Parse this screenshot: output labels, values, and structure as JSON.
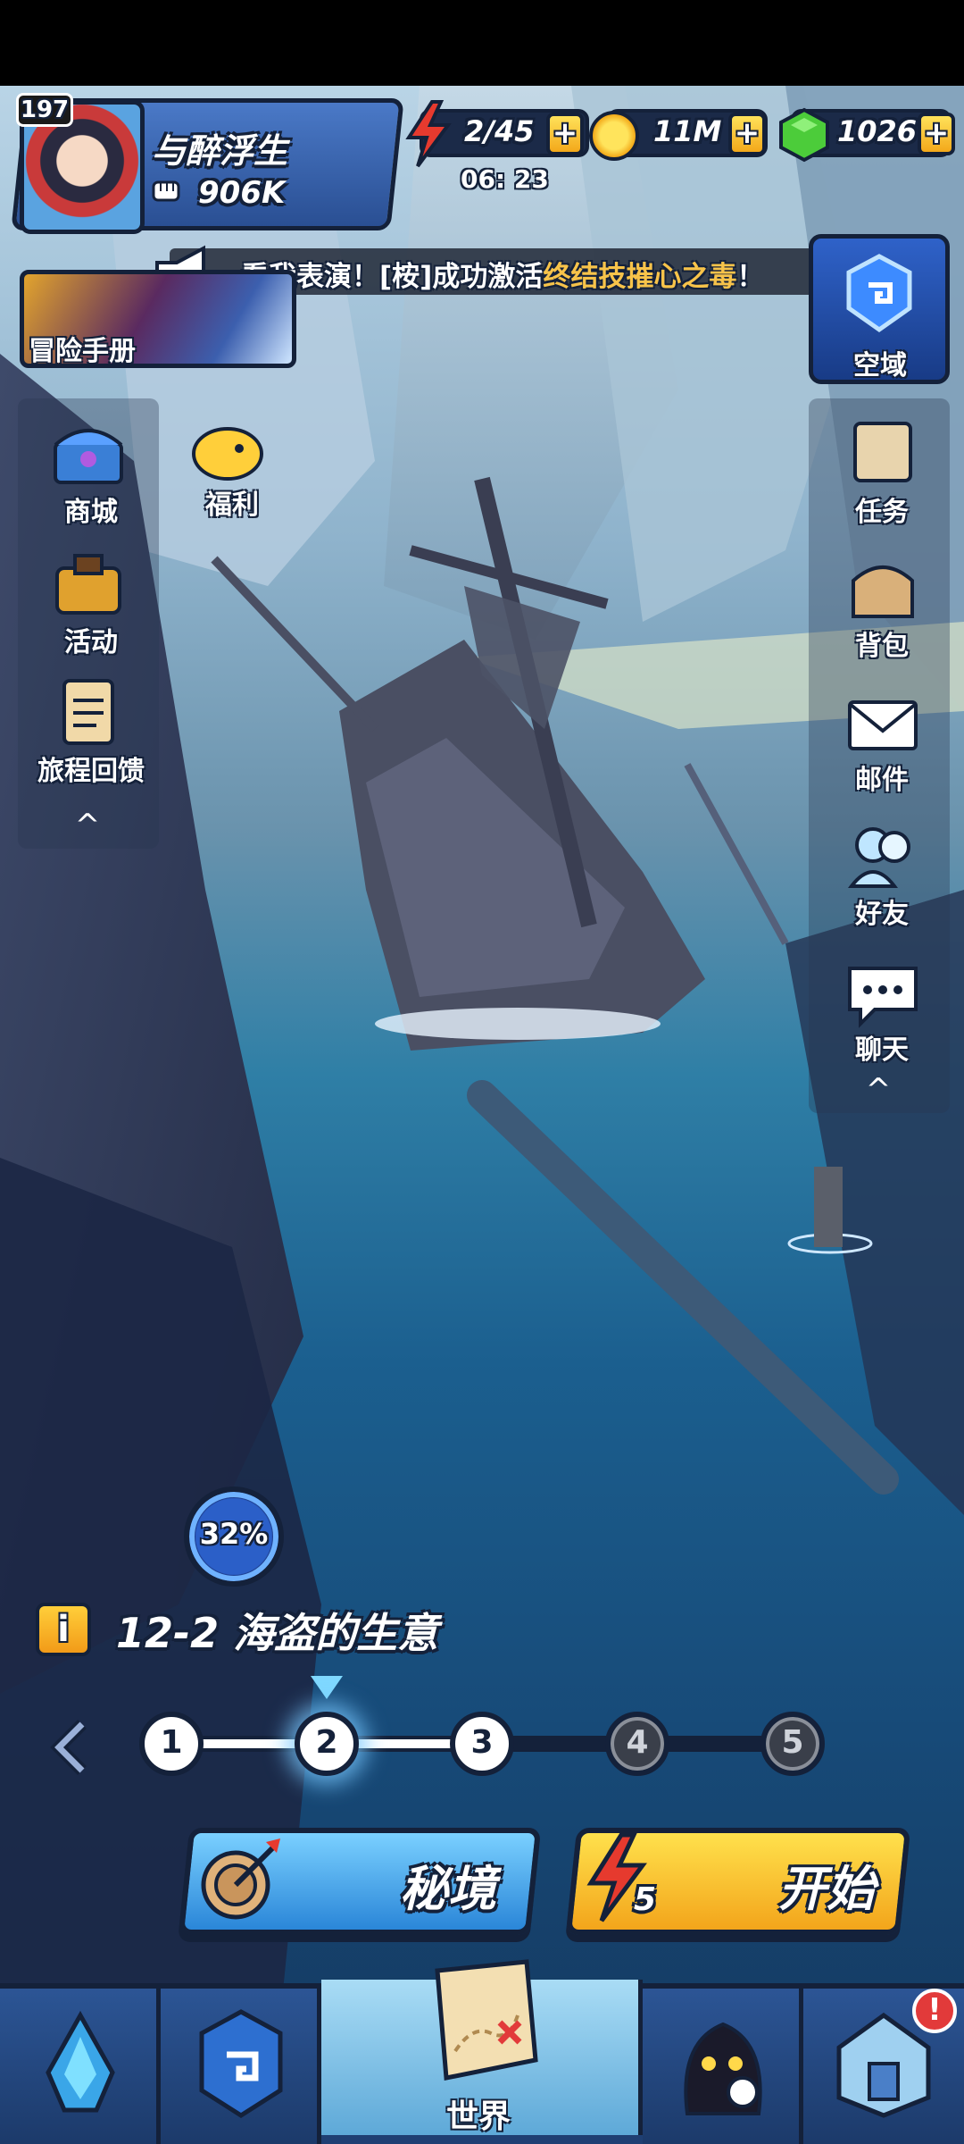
{
  "player": {
    "level": "197",
    "name": "与醉浮生",
    "power": "906K"
  },
  "resources": {
    "energy": "2/45",
    "energy_timer": "06: 23",
    "gold": "11M",
    "gems": "1026",
    "plus": "+"
  },
  "announcement": {
    "prefix": "看我表演！[桉]成功激活",
    "highlight": "终结技摧心之毒",
    "suffix": "！"
  },
  "buttons": {
    "adventure_handbook": "冒险手册",
    "airspace": "空域"
  },
  "left_menu": {
    "items": [
      {
        "label": "商城",
        "icon": "treasure-chest-icon"
      },
      {
        "label": "福利",
        "icon": "golden-pig-icon"
      },
      {
        "label": "活动",
        "icon": "treasure-bag-icon"
      },
      {
        "label": "旅程回馈",
        "icon": "clipboard-icon"
      }
    ],
    "collapse": "^"
  },
  "right_menu": {
    "items": [
      {
        "label": "任务",
        "icon": "scroll-icon"
      },
      {
        "label": "背包",
        "icon": "backpack-icon"
      },
      {
        "label": "邮件",
        "icon": "mail-icon"
      },
      {
        "label": "好友",
        "icon": "friends-icon"
      },
      {
        "label": "聊天",
        "icon": "chat-icon"
      }
    ],
    "collapse": "^"
  },
  "stage": {
    "progress": "32%",
    "info": "i",
    "title": "12-2 海盗的生意",
    "nodes": [
      "1",
      "2",
      "3",
      "4",
      "5"
    ],
    "current": 2
  },
  "actions": {
    "secret_realm": "秘境",
    "start": "开始",
    "start_cost": "5"
  },
  "bottom_nav": {
    "tabs": [
      {
        "icon": "crystal-icon"
      },
      {
        "icon": "rune-shield-icon"
      },
      {
        "icon": "treasure-map-icon",
        "label": "世界"
      },
      {
        "icon": "shadow-hero-icon"
      },
      {
        "icon": "floating-house-icon"
      }
    ],
    "alert": "!"
  },
  "colors": {
    "outline": "#14213a",
    "gold_highlight": "#f7c34a",
    "sea": "#1b5f8f",
    "start_button": "#f3a51b",
    "secret_button": "#2a86d8"
  }
}
